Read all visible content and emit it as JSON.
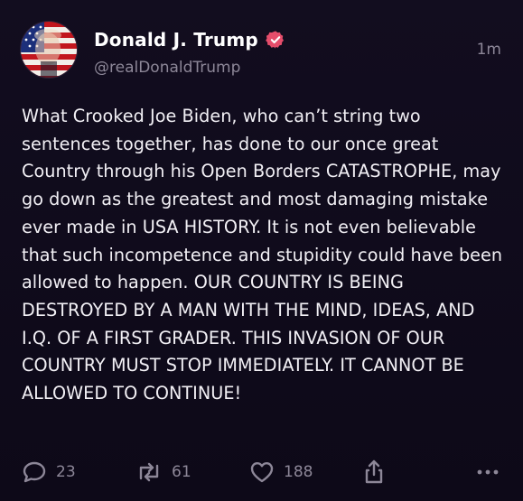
{
  "post": {
    "author": {
      "display_name": "Donald J. Trump",
      "handle": "@realDonaldTrump",
      "verified": true,
      "avatar_icon": "avatar-flag-portrait"
    },
    "timestamp": "1m",
    "text": "What Crooked Joe Biden, who can’t string two sentences together, has done to our once great Country through his Open Borders CATASTROPHE, may go down as the greatest and most damaging mistake ever made in USA HISTORY. It is not even believable that such incompetence and stupidity could have been allowed to happen. OUR COUNTRY IS BEING DESTROYED BY A MAN WITH THE MIND, IDEAS, AND I.Q. OF A FIRST GRADER. THIS INVASION OF OUR COUNTRY MUST STOP IMMEDIATELY. IT CANNOT BE ALLOWED TO CONTINUE!",
    "actions": {
      "replies": "23",
      "retruths": "61",
      "likes": "188"
    }
  },
  "colors": {
    "background": "#0f0b1a",
    "text": "#f2f0f5",
    "muted": "#8d8798",
    "verified_badge": "#e54d6b"
  },
  "icons": {
    "reply": "speech-bubble-icon",
    "retruth": "repost-arrows-icon",
    "like": "heart-icon",
    "share": "share-upload-icon",
    "more": "ellipsis-icon",
    "verified": "verified-badge-icon"
  }
}
